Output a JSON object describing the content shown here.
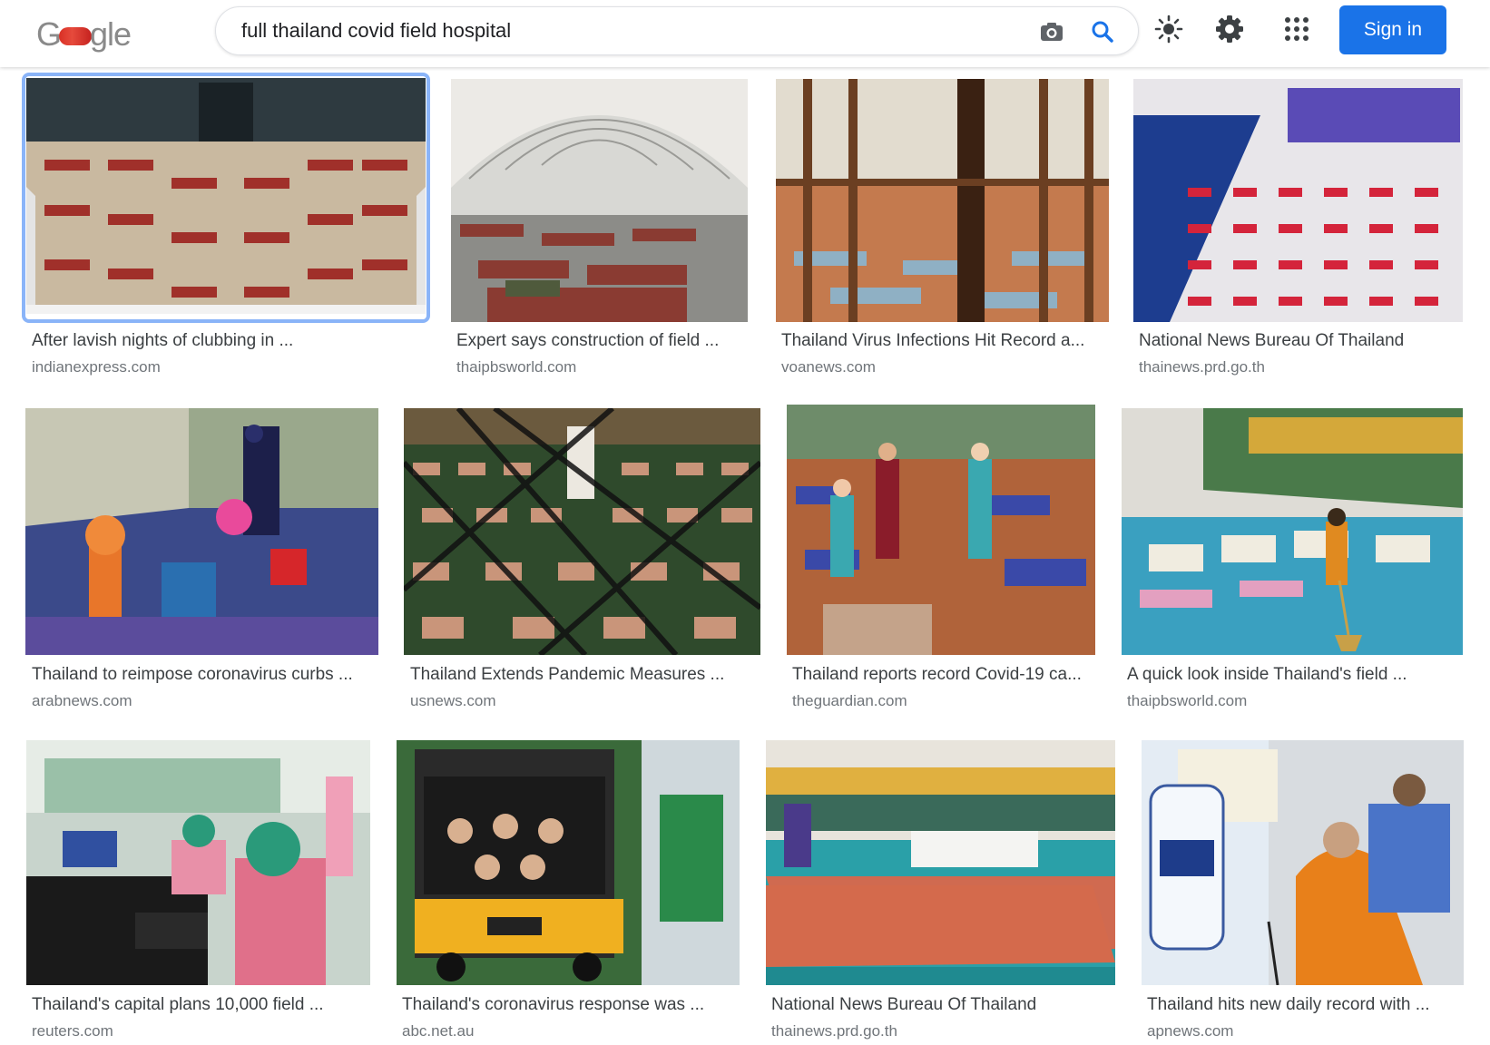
{
  "header": {
    "logo_text": "Google",
    "search_value": "full thailand covid field hospital",
    "sign_in_label": "Sign in",
    "icons": [
      "camera-icon",
      "search-icon",
      "brightness-icon",
      "gear-icon",
      "apps-grid-icon"
    ],
    "accent_color": "#1a73e8"
  },
  "results": [
    {
      "title": "After lavish nights of clubbing in ...",
      "source": "indianexpress.com",
      "selected": true
    },
    {
      "title": "Expert says construction of field ...",
      "source": "thaipbsworld.com"
    },
    {
      "title": "Thailand Virus Infections Hit Record a...",
      "source": "voanews.com"
    },
    {
      "title": "National News Bureau Of Thailand",
      "source": "thainews.prd.go.th"
    },
    {
      "title": "Thailand to reimpose coronavirus curbs ...",
      "source": "arabnews.com"
    },
    {
      "title": "Thailand Extends Pandemic Measures ...",
      "source": "usnews.com"
    },
    {
      "title": "Thailand reports record Covid-19 ca...",
      "source": "theguardian.com"
    },
    {
      "title": "A quick look inside Thailand's field ...",
      "source": "thaipbsworld.com"
    },
    {
      "title": "Thailand's capital plans 10,000 field ...",
      "source": "reuters.com"
    },
    {
      "title": "Thailand's coronavirus response was ...",
      "source": "abc.net.au"
    },
    {
      "title": "National News Bureau Of Thailand",
      "source": "thainews.prd.go.th"
    },
    {
      "title": "Thailand hits new daily record with ...",
      "source": "apnews.com"
    }
  ]
}
